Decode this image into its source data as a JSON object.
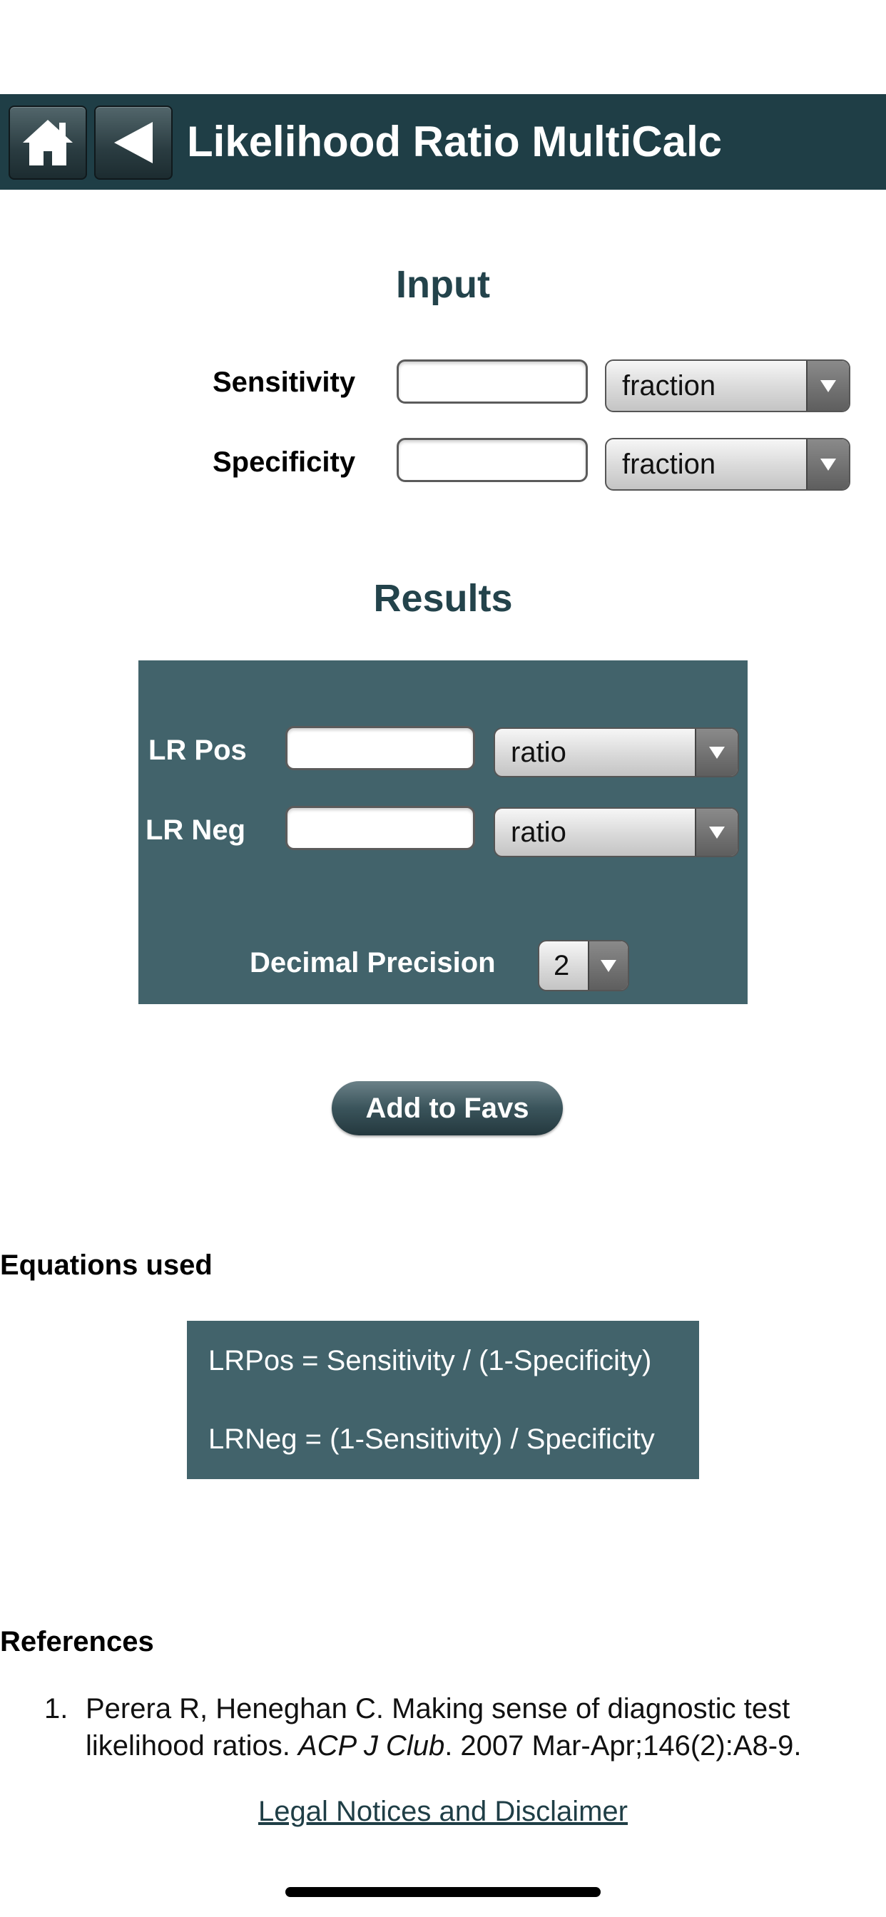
{
  "header": {
    "title": "Likelihood Ratio MultiCalc",
    "home_icon": "home-icon",
    "back_icon": "back-triangle-icon",
    "color": "#1f3e46"
  },
  "input": {
    "title": "Input",
    "sensitivity": {
      "label": "Sensitivity",
      "value": "",
      "unit": "fraction"
    },
    "specificity": {
      "label": "Specificity",
      "value": "",
      "unit": "fraction"
    }
  },
  "results": {
    "title": "Results",
    "lr_pos": {
      "label": "LR Pos",
      "value": "",
      "unit": "ratio"
    },
    "lr_neg": {
      "label": "LR Neg",
      "value": "",
      "unit": "ratio"
    },
    "decimal_precision": {
      "label": "Decimal Precision",
      "value": "2"
    },
    "box_color": "#42636b"
  },
  "actions": {
    "add_to_favs": "Add to Favs"
  },
  "equations": {
    "title": "Equations used",
    "lines": [
      "LRPos = Sensitivity / (1-Specificity)",
      "LRNeg = (1-Sensitivity) / Specificity"
    ]
  },
  "references": {
    "title": "References",
    "items": [
      {
        "num": "1.",
        "text_before": "Perera R, Heneghan C. Making sense of diagnostic test likelihood ratios. ",
        "journal": "ACP J Club",
        "text_after": ". 2007 Mar-Apr;146(2):A8-9."
      }
    ]
  },
  "footer": {
    "legal_link": "Legal Notices and Disclaimer"
  }
}
